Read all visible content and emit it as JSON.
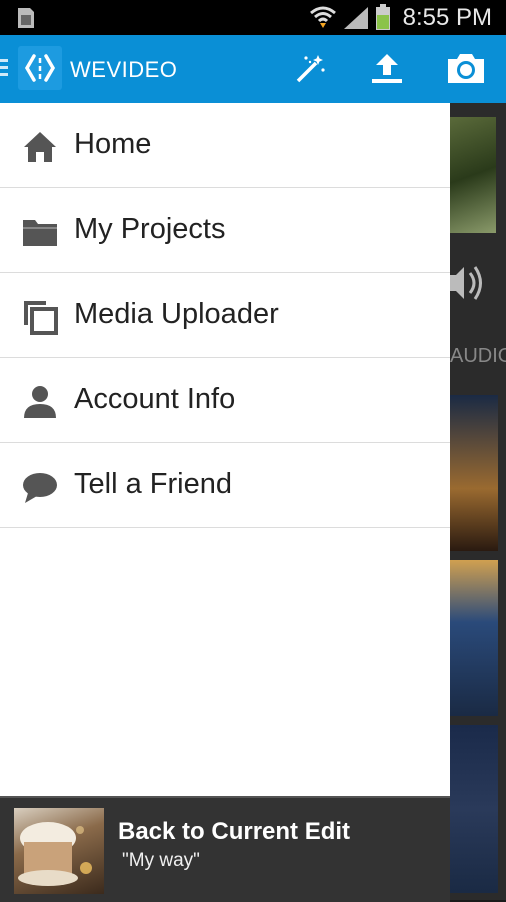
{
  "status_bar": {
    "time": "8:55 PM"
  },
  "app_bar": {
    "brand": "WEVIDEO"
  },
  "menu": [
    {
      "label": "Home",
      "icon": "home-icon"
    },
    {
      "label": "My Projects",
      "icon": "folder-icon"
    },
    {
      "label": "Media Uploader",
      "icon": "media-uploader-icon"
    },
    {
      "label": "Account Info",
      "icon": "person-icon"
    },
    {
      "label": "Tell a Friend",
      "icon": "chat-bubble-icon"
    }
  ],
  "background_peek": {
    "audio_label": "AUDIO"
  },
  "back_to_edit": {
    "title": "Back to Current Edit",
    "project": "\"My way\""
  },
  "colors": {
    "appbar": "#0a8fd6",
    "drawer": "#ffffff",
    "bottom_bar": "#333333"
  }
}
